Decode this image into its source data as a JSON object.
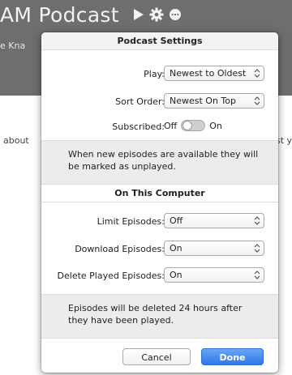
{
  "background": {
    "title": "AM Podcast",
    "subtitle": "e Kna",
    "about_text": "about",
    "right_text": "st ye",
    "icons": [
      "play-icon",
      "gear-icon",
      "more-icon"
    ]
  },
  "dialog": {
    "title": "Podcast Settings",
    "play": {
      "label": "Play:",
      "value": "Newest to Oldest"
    },
    "sort_order": {
      "label": "Sort Order:",
      "value": "Newest On Top"
    },
    "subscribed": {
      "label": "Subscribed:",
      "off_label": "Off",
      "on_label": "On",
      "state": "off"
    },
    "subscribed_note": "When new episodes are available they will be marked as unplayed.",
    "section_title": "On This Computer",
    "limit_episodes": {
      "label": "Limit Episodes:",
      "value": "Off"
    },
    "download_episodes": {
      "label": "Download Episodes:",
      "value": "On"
    },
    "delete_played": {
      "label": "Delete Played Episodes:",
      "value": "On"
    },
    "delete_note": "Episodes will be deleted 24 hours after they have been played.",
    "cancel_label": "Cancel",
    "done_label": "Done"
  },
  "colors": {
    "header_bg": "#6e6e6e",
    "accent": "#2f75e6"
  }
}
